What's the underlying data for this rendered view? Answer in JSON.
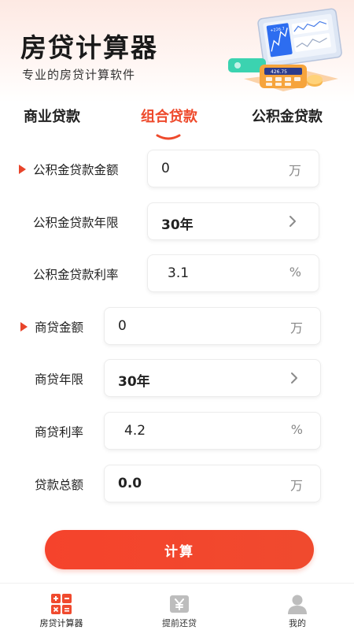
{
  "header": {
    "title": "房贷计算器",
    "subtitle": "专业的房贷计算软件"
  },
  "tabs": [
    {
      "label": "商业贷款",
      "active": false
    },
    {
      "label": "组合贷款",
      "active": true
    },
    {
      "label": "公积金贷款",
      "active": false
    }
  ],
  "form": {
    "fund_amount": {
      "label": "公积金贷款金额",
      "value": "0",
      "unit": "万",
      "required": true
    },
    "fund_years": {
      "label": "公积金贷款年限",
      "value": "30年"
    },
    "fund_rate": {
      "label": "公积金贷款利率",
      "value": "3.1",
      "unit": "%"
    },
    "biz_amount": {
      "label": "商贷金额",
      "value": "0",
      "unit": "万",
      "required": true
    },
    "biz_years": {
      "label": "商贷年限",
      "value": "30年"
    },
    "biz_rate": {
      "label": "商贷利率",
      "value": "4.2",
      "unit": "%"
    },
    "total": {
      "label": "贷款总额",
      "value": "0.0",
      "unit": "万"
    }
  },
  "calculate_label": "计算",
  "illustration_chart_label": "+226.7",
  "illustration_device_label": "426.75",
  "tabbar": [
    {
      "label": "房贷计算器",
      "icon": "calculator-icon",
      "active": true
    },
    {
      "label": "提前还贷",
      "icon": "yuan-icon",
      "active": false
    },
    {
      "label": "我的",
      "icon": "user-icon",
      "active": false
    }
  ],
  "colors": {
    "accent": "#ee4a2c",
    "button": "#f5432c",
    "marker": "#e8442a"
  }
}
